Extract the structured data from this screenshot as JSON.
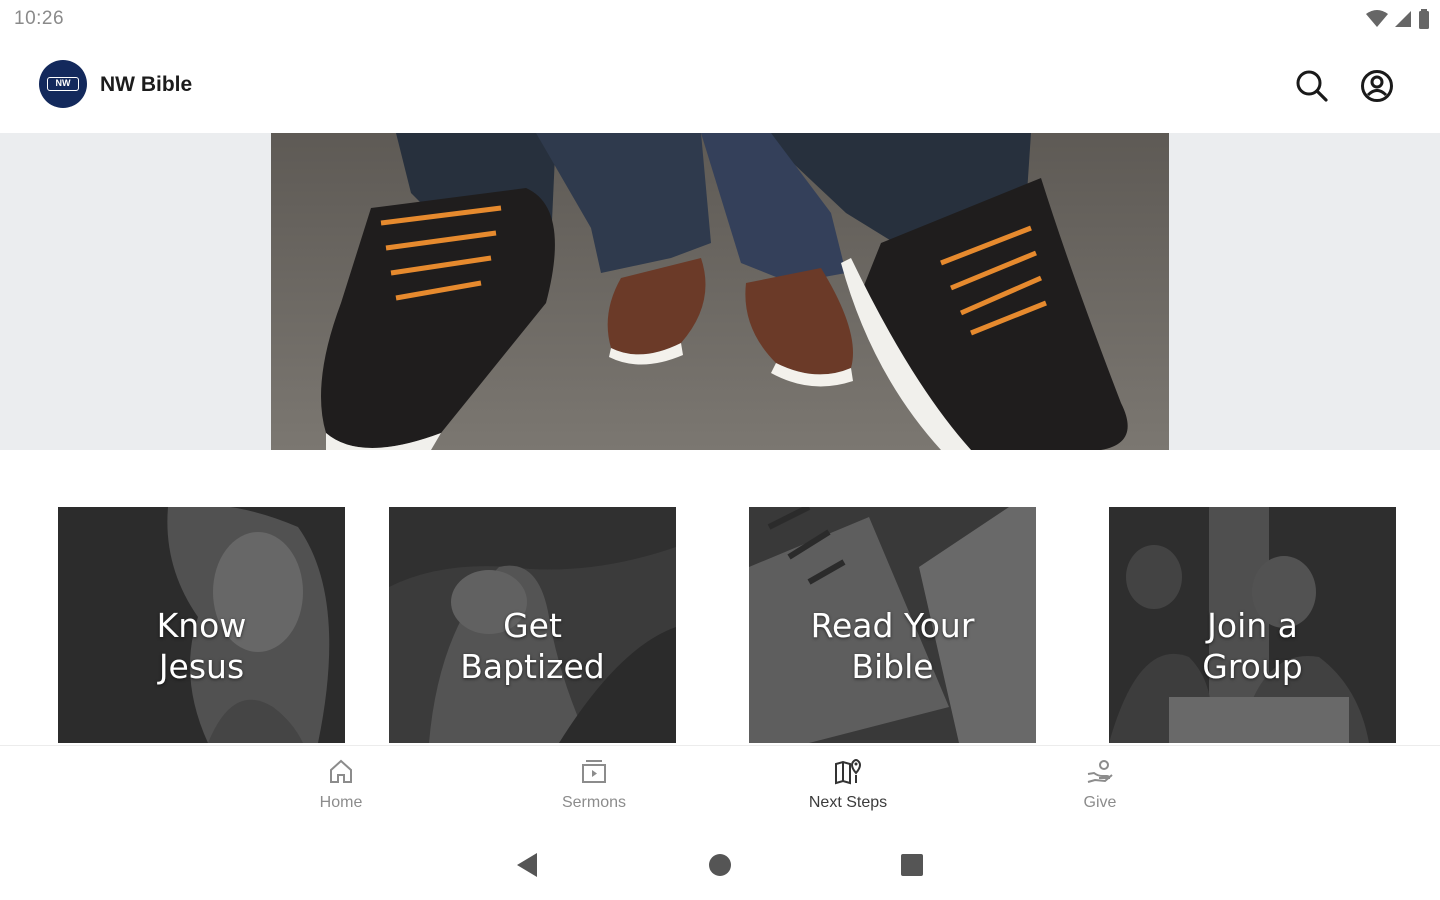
{
  "status_bar": {
    "time": "10:26"
  },
  "app_bar": {
    "logo_text": "NW",
    "title": "NW Bible"
  },
  "cards": [
    {
      "label": "Know\nJesus"
    },
    {
      "label": "Get\nBaptized"
    },
    {
      "label": "Read Your\nBible"
    },
    {
      "label": "Join a\nGroup"
    }
  ],
  "bottom_nav": {
    "items": [
      {
        "label": "Home",
        "icon": "home-icon"
      },
      {
        "label": "Sermons",
        "icon": "sermons-icon"
      },
      {
        "label": "Next Steps",
        "icon": "next-steps-icon",
        "active": true
      },
      {
        "label": "Give",
        "icon": "give-icon"
      }
    ]
  },
  "colors": {
    "logo_bg": "#13295c",
    "banner_bg": "#ebedef",
    "nav_label": "#8c8c8c"
  }
}
